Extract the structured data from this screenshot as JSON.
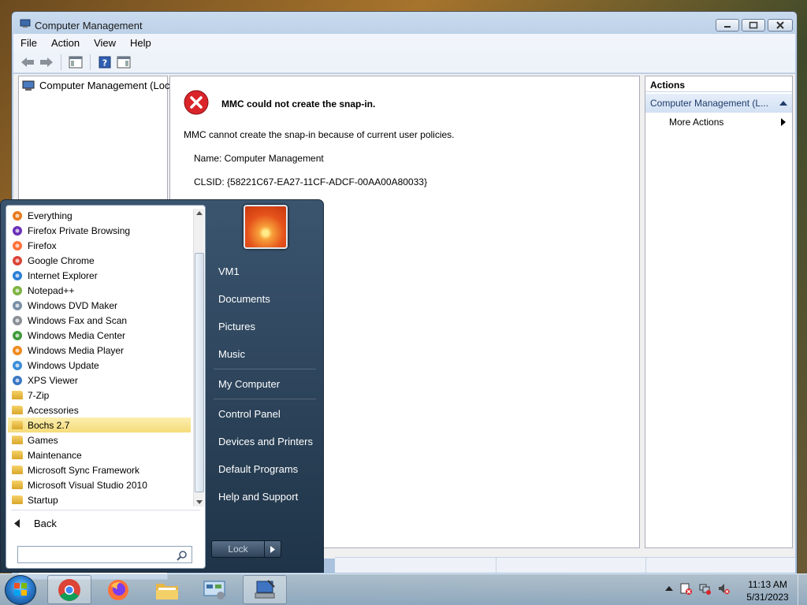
{
  "window": {
    "title": "Computer Management",
    "menu": [
      "File",
      "Action",
      "View",
      "Help"
    ]
  },
  "tree": {
    "root_label": "Computer Management (Local"
  },
  "error": {
    "title": "MMC could not create the snap-in.",
    "message": "MMC cannot create the snap-in because of current user policies.",
    "name_line": "Name: Computer Management",
    "clsid_line": "CLSID: {58221C67-EA27-11CF-ADCF-00AA00A80033}"
  },
  "actions": {
    "header": "Actions",
    "section": "Computer Management (L...",
    "more": "More Actions"
  },
  "start_menu": {
    "programs": [
      {
        "label": "Everything",
        "icon": "everything-icon"
      },
      {
        "label": "Firefox Private Browsing",
        "icon": "firefox-private-icon"
      },
      {
        "label": "Firefox",
        "icon": "firefox-icon"
      },
      {
        "label": "Google Chrome",
        "icon": "chrome-icon"
      },
      {
        "label": "Internet Explorer",
        "icon": "ie-icon"
      },
      {
        "label": "Notepad++",
        "icon": "notepadpp-icon"
      },
      {
        "label": "Windows DVD Maker",
        "icon": "dvd-maker-icon"
      },
      {
        "label": "Windows Fax and Scan",
        "icon": "fax-scan-icon"
      },
      {
        "label": "Windows Media Center",
        "icon": "media-center-icon"
      },
      {
        "label": "Windows Media Player",
        "icon": "media-player-icon"
      },
      {
        "label": "Windows Update",
        "icon": "windows-update-icon"
      },
      {
        "label": "XPS Viewer",
        "icon": "xps-viewer-icon"
      },
      {
        "label": "7-Zip",
        "icon": "folder-icon"
      },
      {
        "label": "Accessories",
        "icon": "folder-icon"
      },
      {
        "label": "Bochs 2.7",
        "icon": "folder-icon"
      },
      {
        "label": "Games",
        "icon": "folder-icon"
      },
      {
        "label": "Maintenance",
        "icon": "folder-icon"
      },
      {
        "label": "Microsoft Sync Framework",
        "icon": "folder-icon"
      },
      {
        "label": "Microsoft Visual Studio 2010",
        "icon": "folder-icon"
      },
      {
        "label": "Startup",
        "icon": "folder-icon"
      }
    ],
    "back": "Back",
    "search_value": "",
    "right_items": [
      "VM1",
      "Documents",
      "Pictures",
      "Music",
      "My Computer",
      "Control Panel",
      "Devices and Printers",
      "Default Programs",
      "Help and Support"
    ],
    "lock": "Lock"
  },
  "taskbar": {
    "time": "11:13 AM",
    "date": "5/31/2023"
  },
  "colors": {
    "highlight": "#f5dc7a",
    "error_red": "#d9252a",
    "action_blue": "#1f3b6b"
  }
}
